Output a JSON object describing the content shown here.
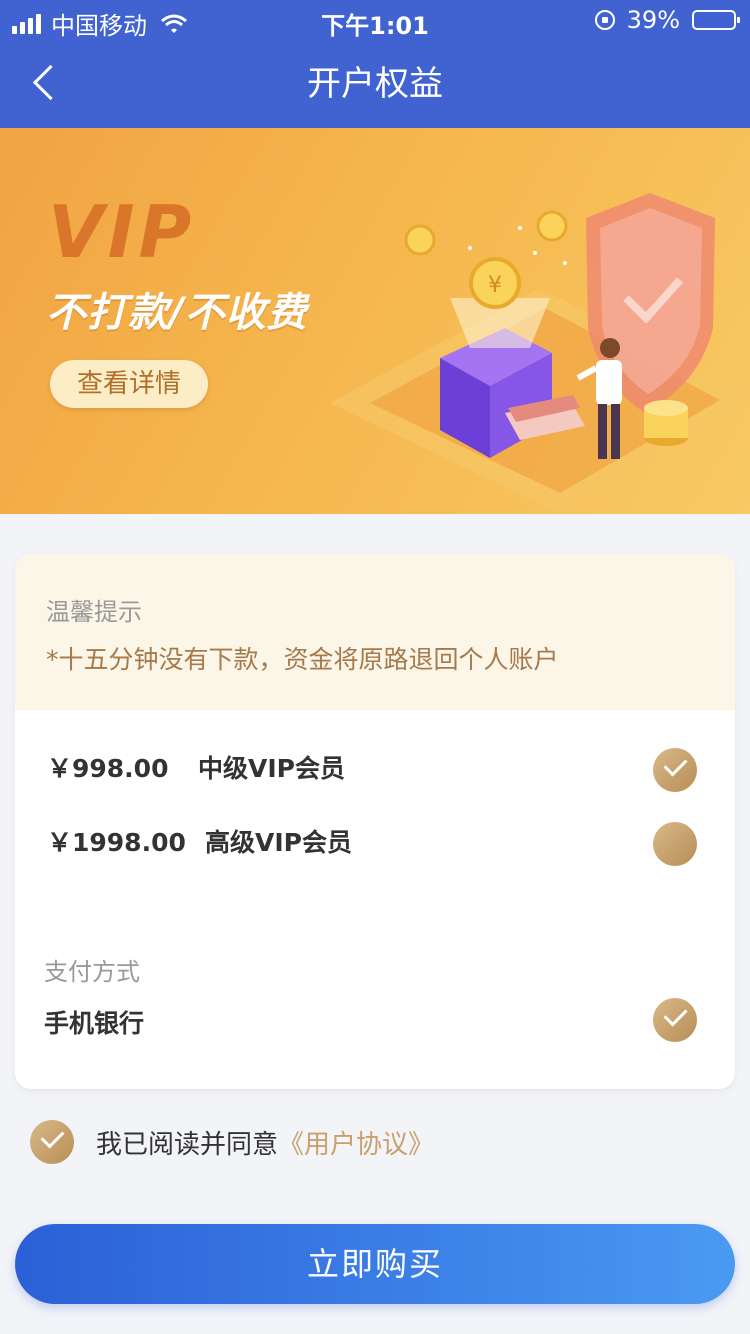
{
  "status_bar": {
    "carrier": "中国移动",
    "time": "下午1:01",
    "battery": "39%",
    "battery_level": 0.39
  },
  "nav": {
    "title": "开户权益"
  },
  "banner": {
    "headline": "VIP",
    "slogan": "不打款/不收费",
    "detail_button": "查看详情"
  },
  "tips": {
    "title": "温馨提示",
    "text": "*十五分钟没有下款，资金将原路退回个人账户"
  },
  "plans": [
    {
      "price": "￥998.00",
      "name": "中级VIP会员",
      "selected": true
    },
    {
      "price": "￥1998.00",
      "name": "高级VIP会员",
      "selected": false
    }
  ],
  "payment": {
    "title": "支付方式",
    "method": "手机银行",
    "selected": true
  },
  "agreement": {
    "text": "我已阅读并同意",
    "link": "《用户协议》",
    "checked": true
  },
  "buy_button": "立即购买",
  "colors": {
    "header": "#4063d1",
    "accent_gold": "#c9a06b",
    "button_gradient_start": "#2b60d6",
    "button_gradient_end": "#4a9af2"
  }
}
